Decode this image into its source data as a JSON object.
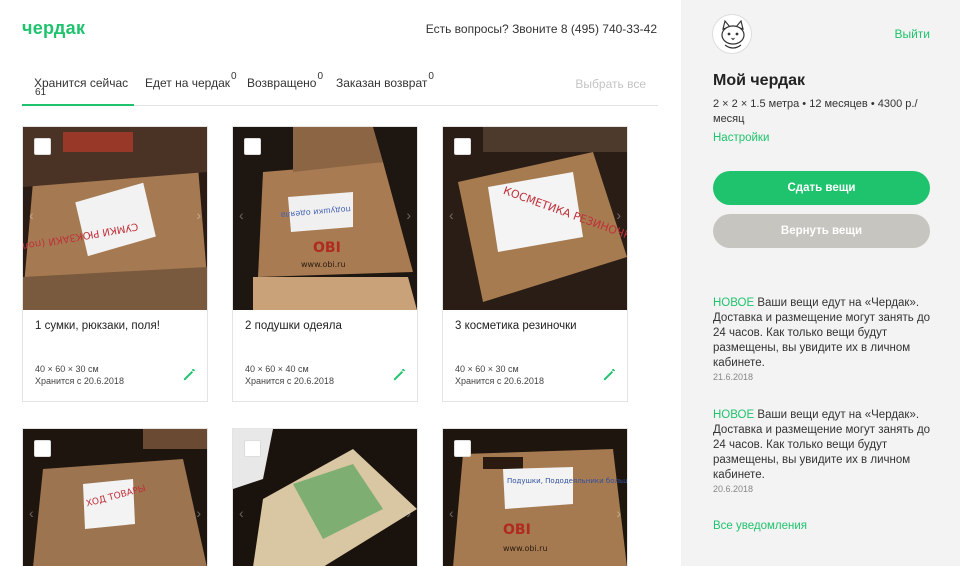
{
  "header": {
    "logo": "чердак",
    "phone_text": "Есть вопросы? Звоните 8 (495) 740-33-42"
  },
  "tabs": [
    {
      "label": "Хранится сейчас",
      "count": "61"
    },
    {
      "label": "Едет на чердак",
      "count": "0"
    },
    {
      "label": "Возвращено",
      "count": "0"
    },
    {
      "label": "Заказан возврат",
      "count": "0"
    }
  ],
  "select_all": "Выбрать все",
  "items": [
    {
      "title": "1 сумки, рюкзаки, поля!",
      "dims": "40 × 60 × 30 см",
      "stored": "Хранится с 20.6.2018",
      "photo_note": "СУМКИ РЮКЗАКИ (поля)"
    },
    {
      "title": "2 подушки одеяла",
      "dims": "40 × 60 × 40 см",
      "stored": "Хранится с 20.6.2018",
      "photo_note": "подушки одеяла"
    },
    {
      "title": "3 косметика резиночки",
      "dims": "40 × 60 × 30 см",
      "stored": "Хранится с 20.6.2018",
      "photo_note": "КОСМЕТИКА РЕЗИНОЧКИ"
    },
    {
      "photo_note": "ХОД ТОВАРЫ"
    },
    {
      "photo_note": ""
    },
    {
      "photo_note": "Подушки, Пододеяльники больше"
    }
  ],
  "box_print": {
    "brand": "OBI",
    "site": "www.obi.ru"
  },
  "sidebar": {
    "logout": "Выйти",
    "plan_title": "Мой чердак",
    "plan_info": "2 × 2 × 1.5 метра • 12 месяцев • 4300 р./месяц",
    "settings": "Настройки",
    "give_button": "Сдать вещи",
    "return_button": "Вернуть вещи",
    "notifications": [
      {
        "badge": "НОВОЕ",
        "text": "Ваши вещи едут на «Чердак». Доставка и размещение могут занять до 24 часов. Как только вещи будут размещены, вы увидите их в личном кабинете.",
        "date": "21.6.2018"
      },
      {
        "badge": "НОВОЕ",
        "text": "Ваши вещи едут на «Чердак». Доставка и размещение могут занять до 24 часов. Как только вещи будут размещены, вы увидите их в личном кабинете.",
        "date": "20.6.2018"
      }
    ],
    "all_notifications": "Все уведомления"
  },
  "colors": {
    "accent": "#1fc36d",
    "muted_button": "#c7c5c0",
    "sidebar_bg": "#f3f3f3"
  },
  "icons": {
    "edit": "pencil-icon",
    "avatar": "cat-icon",
    "prev": "chevron-left-icon",
    "next": "chevron-right-icon"
  }
}
